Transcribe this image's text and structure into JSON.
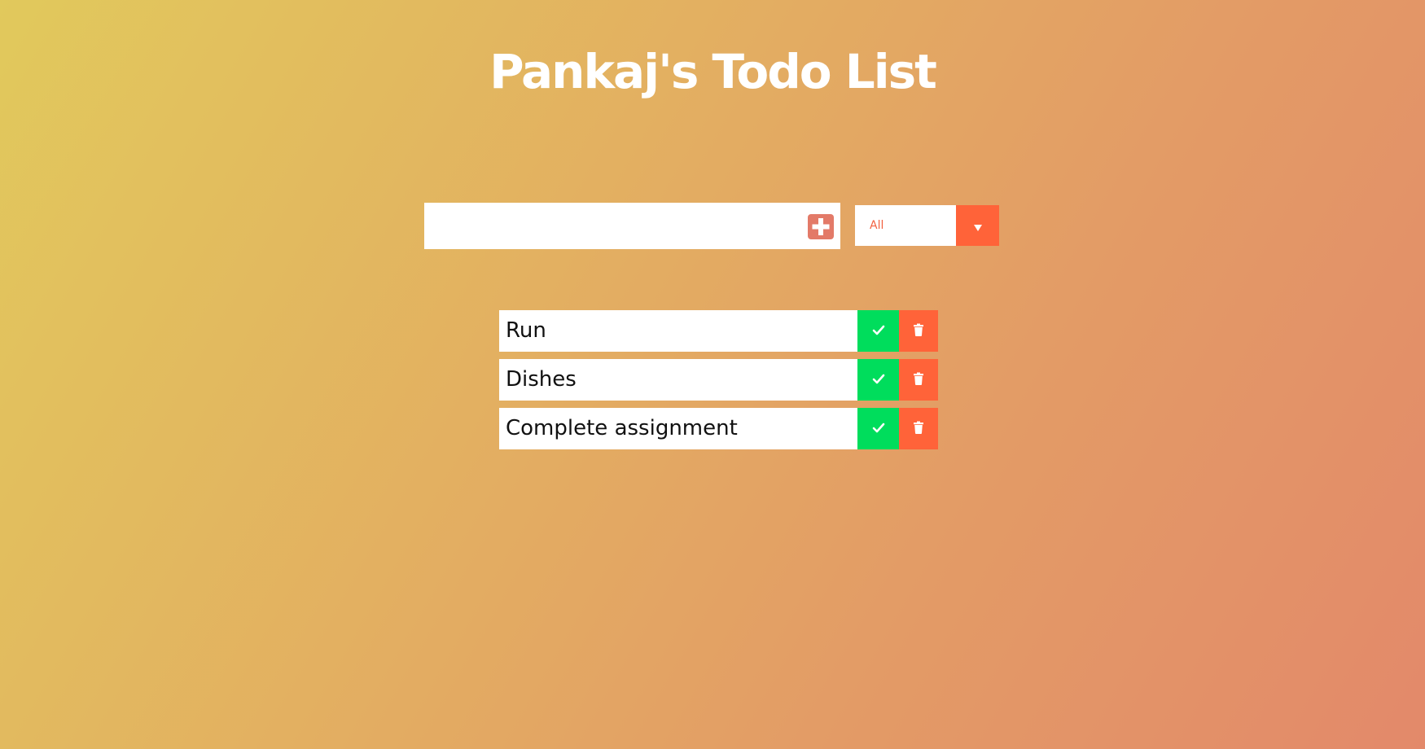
{
  "header": {
    "title": "Pankaj's Todo List"
  },
  "form": {
    "input_value": "",
    "add_icon": "plus-square-icon",
    "filter": {
      "selected": "All",
      "arrow_icon": "caret-down-icon"
    }
  },
  "todos": [
    {
      "text": "Run",
      "complete_icon": "check-icon",
      "delete_icon": "trash-icon"
    },
    {
      "text": "Dishes",
      "complete_icon": "check-icon",
      "delete_icon": "trash-icon"
    },
    {
      "text": "Complete assignment",
      "complete_icon": "check-icon",
      "delete_icon": "trash-icon"
    }
  ],
  "colors": {
    "gradient_start": "#e1c95c",
    "gradient_end": "#e3896a",
    "title_text": "#ffffff",
    "add_button": "#e37a68",
    "filter_accent": "#ff6339",
    "complete_button": "#00dd5c",
    "trash_button": "#ff6339"
  }
}
